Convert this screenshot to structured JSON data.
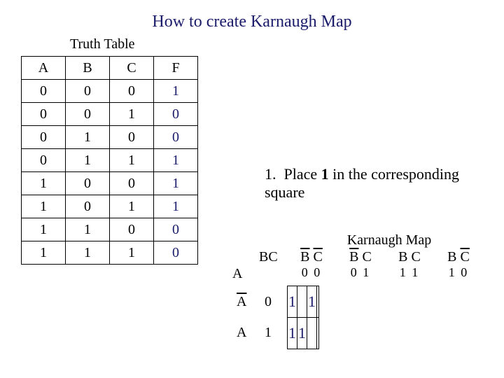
{
  "title": "How to create Karnaugh Map",
  "truth_label": "Truth Table",
  "truth_headers": [
    "A",
    "B",
    "C",
    "F"
  ],
  "truth_rows": [
    [
      "0",
      "0",
      "0",
      "1"
    ],
    [
      "0",
      "0",
      "1",
      "0"
    ],
    [
      "0",
      "1",
      "0",
      "0"
    ],
    [
      "0",
      "1",
      "1",
      "1"
    ],
    [
      "1",
      "0",
      "0",
      "1"
    ],
    [
      "1",
      "0",
      "1",
      "1"
    ],
    [
      "1",
      "1",
      "0",
      "0"
    ],
    [
      "1",
      "1",
      "1",
      "0"
    ]
  ],
  "instruction": {
    "num": "1.",
    "text": "Place 1 in the corresponding square",
    "bold": "1"
  },
  "kmap_label": "Karnaugh Map",
  "kmap": {
    "corner_bc": "BC",
    "corner_a": "A",
    "cols": [
      {
        "bbar": true,
        "cbar": true,
        "bits": "0 0"
      },
      {
        "bbar": true,
        "cbar": false,
        "bits": "0 1"
      },
      {
        "bbar": false,
        "cbar": false,
        "bits": "1 1"
      },
      {
        "bbar": false,
        "cbar": true,
        "bits": "1 0"
      }
    ],
    "rows": [
      {
        "abar": true,
        "bit": "0",
        "cells": [
          "1",
          "",
          "1",
          ""
        ]
      },
      {
        "abar": false,
        "bit": "1",
        "cells": [
          "1",
          "1",
          "",
          ""
        ]
      }
    ]
  },
  "chart_data": {
    "type": "table",
    "truth_table": {
      "columns": [
        "A",
        "B",
        "C",
        "F"
      ],
      "rows": [
        [
          0,
          0,
          0,
          1
        ],
        [
          0,
          0,
          1,
          0
        ],
        [
          0,
          1,
          0,
          0
        ],
        [
          0,
          1,
          1,
          1
        ],
        [
          1,
          0,
          0,
          1
        ],
        [
          1,
          0,
          1,
          1
        ],
        [
          1,
          1,
          0,
          0
        ],
        [
          1,
          1,
          1,
          0
        ]
      ]
    },
    "karnaugh_map": {
      "row_var": "A",
      "col_vars": "BC",
      "col_order_bits": [
        "00",
        "01",
        "11",
        "10"
      ],
      "row_order_bits": [
        "0",
        "1"
      ],
      "grid": [
        [
          1,
          null,
          1,
          null
        ],
        [
          1,
          1,
          null,
          null
        ]
      ]
    }
  }
}
